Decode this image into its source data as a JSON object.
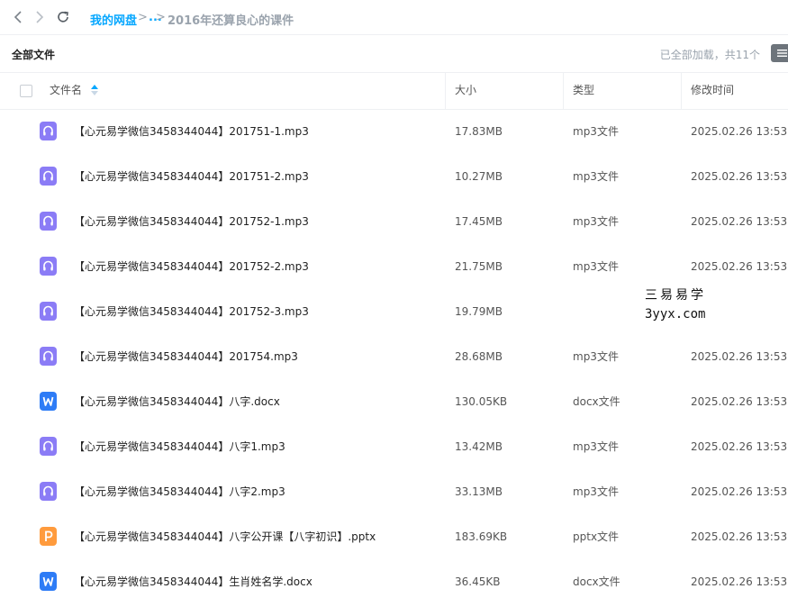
{
  "nav": {
    "back_icon": "chevron-left-icon",
    "forward_icon": "chevron-right-icon",
    "refresh_icon": "refresh-icon",
    "breadcrumb_root": "我的网盘",
    "breadcrumb_sep1": ">",
    "breadcrumb_ellipsis": "...",
    "breadcrumb_sep2": ">",
    "breadcrumb_current": "2016年还算良心的课件"
  },
  "toolbar": {
    "title": "全部文件",
    "loaded_status": "已全部加载，共11个",
    "view_icon": "list-view-icon"
  },
  "table": {
    "headers": {
      "name": "文件名",
      "size": "大小",
      "type": "类型",
      "modified": "修改时间"
    },
    "rows": [
      {
        "icon": "audio-file-icon",
        "name": "【心元易学微信3458344044】201751-1.mp3",
        "size": "17.83MB",
        "type": "mp3文件",
        "modified": "2025.02.26 13:53"
      },
      {
        "icon": "audio-file-icon",
        "name": "【心元易学微信3458344044】201751-2.mp3",
        "size": "10.27MB",
        "type": "mp3文件",
        "modified": "2025.02.26 13:53"
      },
      {
        "icon": "audio-file-icon",
        "name": "【心元易学微信3458344044】201752-1.mp3",
        "size": "17.45MB",
        "type": "mp3文件",
        "modified": "2025.02.26 13:53"
      },
      {
        "icon": "audio-file-icon",
        "name": "【心元易学微信3458344044】201752-2.mp3",
        "size": "21.75MB",
        "type": "mp3文件",
        "modified": "2025.02.26 13:53"
      },
      {
        "icon": "audio-file-icon",
        "name": "【心元易学微信3458344044】201752-3.mp3",
        "size": "19.79MB",
        "type": "",
        "modified": ""
      },
      {
        "icon": "audio-file-icon",
        "name": "【心元易学微信3458344044】201754.mp3",
        "size": "28.68MB",
        "type": "mp3文件",
        "modified": "2025.02.26 13:53"
      },
      {
        "icon": "word-file-icon",
        "name": "【心元易学微信3458344044】八字.docx",
        "size": "130.05KB",
        "type": "docx文件",
        "modified": "2025.02.26 13:53"
      },
      {
        "icon": "audio-file-icon",
        "name": "【心元易学微信3458344044】八字1.mp3",
        "size": "13.42MB",
        "type": "mp3文件",
        "modified": "2025.02.26 13:53"
      },
      {
        "icon": "audio-file-icon",
        "name": "【心元易学微信3458344044】八字2.mp3",
        "size": "33.13MB",
        "type": "mp3文件",
        "modified": "2025.02.26 13:53"
      },
      {
        "icon": "ppt-file-icon",
        "name": "【心元易学微信3458344044】八字公开课【八字初识】.pptx",
        "size": "183.69KB",
        "type": "pptx文件",
        "modified": "2025.02.26 13:53"
      },
      {
        "icon": "word-file-icon",
        "name": "【心元易学微信3458344044】生肖姓名学.docx",
        "size": "36.45KB",
        "type": "docx文件",
        "modified": "2025.02.26 13:53"
      }
    ]
  },
  "watermark": {
    "line1": "三易易学",
    "line2": "3yyx.com"
  },
  "colors": {
    "accent": "#06a7ff",
    "audio_icon": "#8b7cf6",
    "word_icon": "#2e7cf6",
    "ppt_icon": "#ff9b3d",
    "muted": "#9aa3ad"
  }
}
